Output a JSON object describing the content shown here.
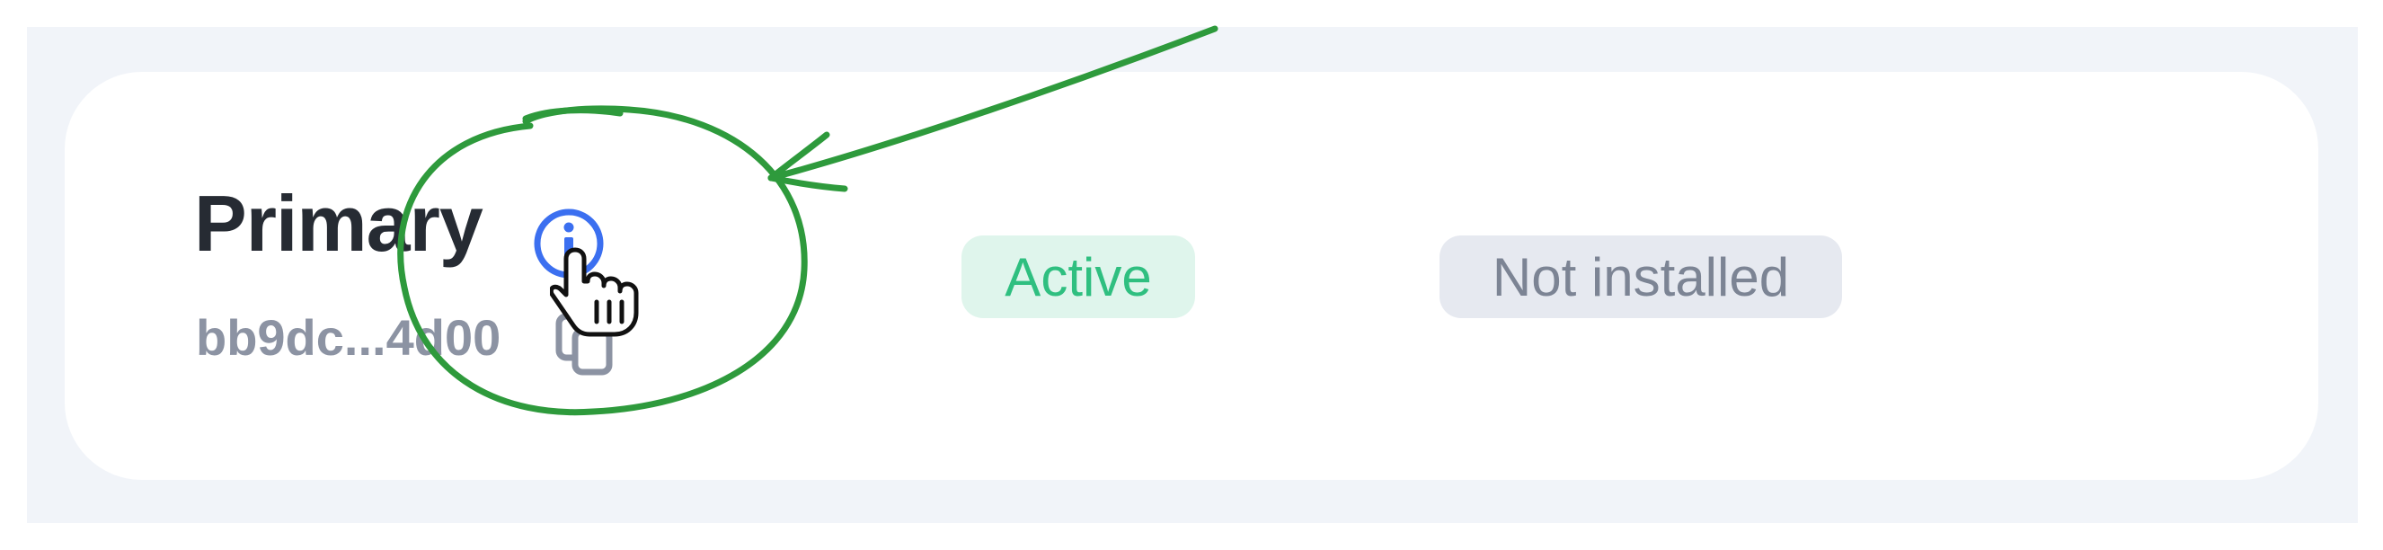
{
  "key": {
    "name": "Primary",
    "id_short": "bb9dc...4d00"
  },
  "icons": {
    "info": "info-circle-icon",
    "copy": "copy-icon",
    "cursor": "hand-pointer-cursor-icon"
  },
  "badges": {
    "status": "Active",
    "install": "Not installed"
  },
  "colors": {
    "panel_bg": "#f1f4f9",
    "card_bg": "#ffffff",
    "title_text": "#262b33",
    "muted_text": "#8c93a3",
    "accent_blue": "#3b6ff0",
    "active_green": "#2fbf80",
    "active_bg": "#dff5ec",
    "neutral_bg": "#e6e9f0",
    "annotation_green": "#2e9a3c"
  }
}
